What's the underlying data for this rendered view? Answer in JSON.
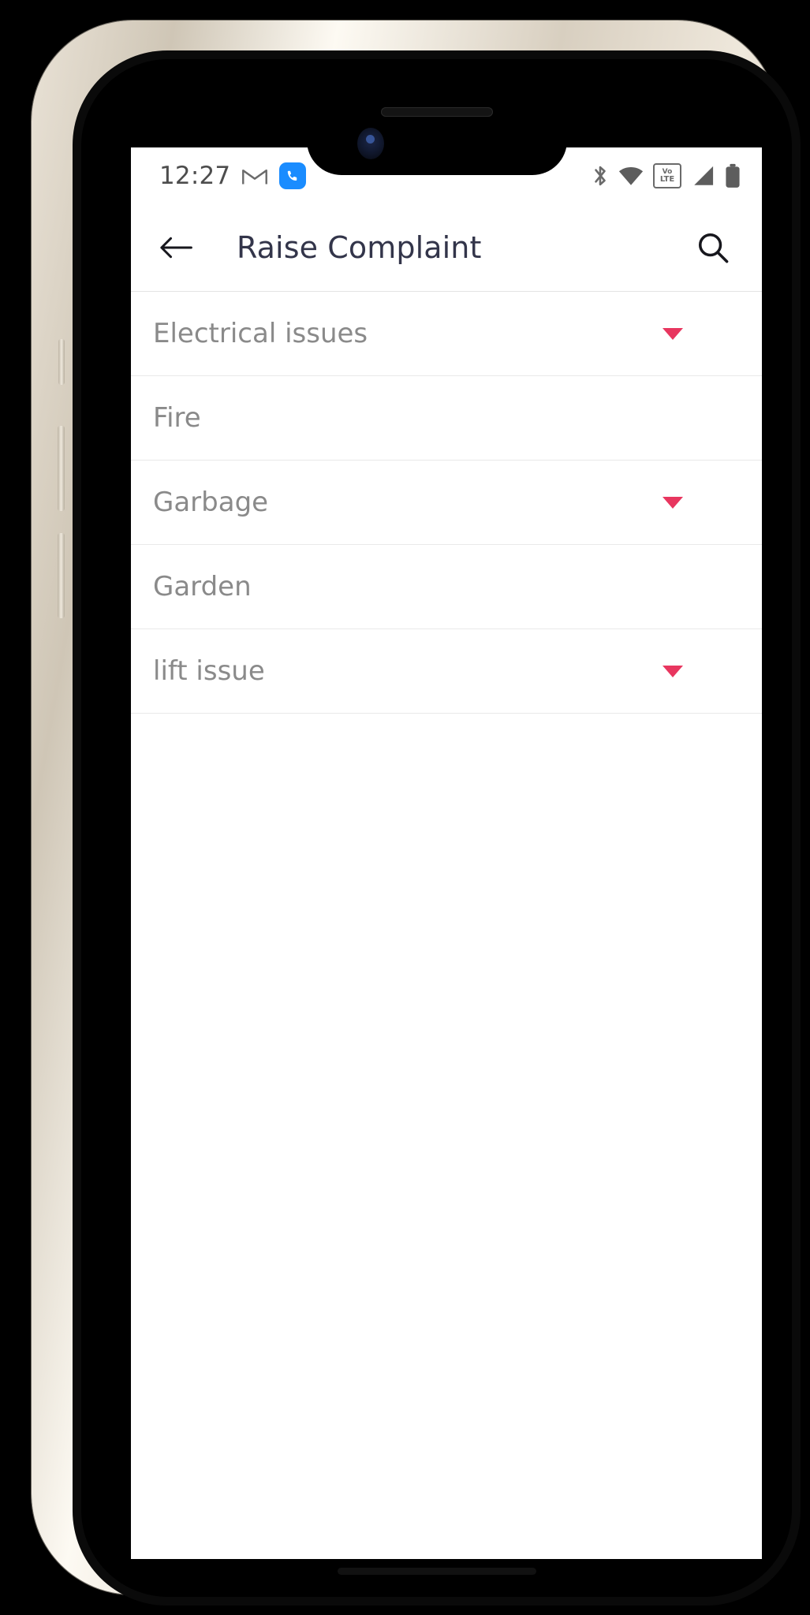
{
  "status_bar": {
    "time": "12:27",
    "left_icons": [
      "gmail-icon",
      "phone-icon"
    ],
    "right_icons": [
      "bluetooth-icon",
      "wifi-icon",
      "volte-icon",
      "signal-icon",
      "battery-icon"
    ],
    "volte_top": "Vo",
    "volte_bottom": "LTE"
  },
  "app_bar": {
    "back_label": "back",
    "title": "Raise Complaint",
    "search_label": "search"
  },
  "list": {
    "rows": [
      {
        "label": "Electrical issues",
        "has_arrow": true
      },
      {
        "label": "Fire",
        "has_arrow": false
      },
      {
        "label": "Garbage",
        "has_arrow": true
      },
      {
        "label": "Garden",
        "has_arrow": false
      },
      {
        "label": "lift issue",
        "has_arrow": true
      }
    ]
  },
  "colors": {
    "arrow": "#e8365f",
    "title": "#33354a",
    "row_text": "#8a8a8a",
    "phone_icon_bg": "#1a8cff",
    "divider": "#e9e9e9"
  }
}
